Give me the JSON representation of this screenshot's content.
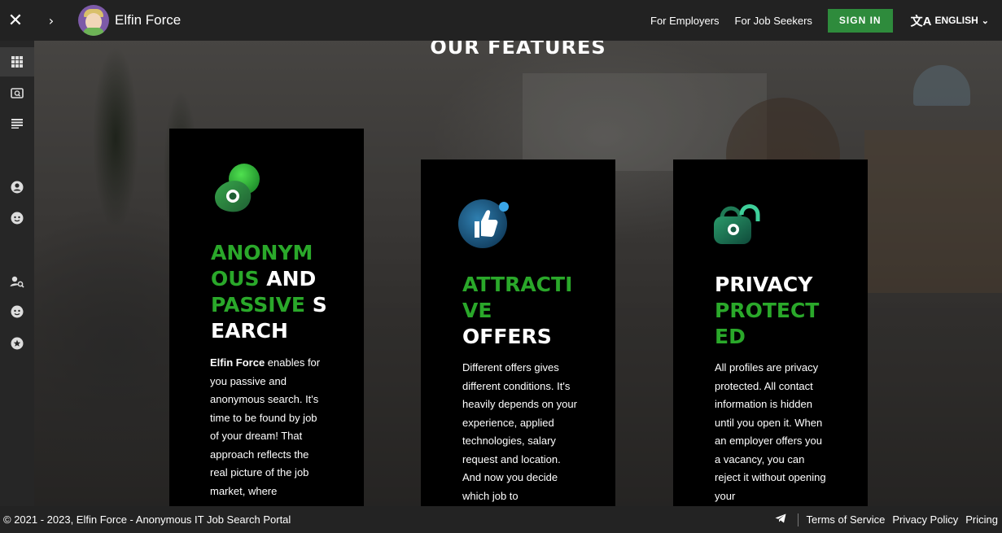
{
  "topbar": {
    "close_icon": "close-icon",
    "expand_icon": "chevron-right-icon",
    "brand": "Elfin Force",
    "for_employers": "For Employers",
    "for_job_seekers": "For Job Seekers",
    "sign_in": "SIGN IN",
    "language": "ENGLISH"
  },
  "sidebar": {
    "icons": [
      "grid-icon",
      "search-screen-icon",
      "list-icon",
      "user-circle-icon",
      "face-icon",
      "user-search-icon",
      "face-icon",
      "star-icon"
    ]
  },
  "main": {
    "section_title": "OUR FEATURES",
    "cards": [
      {
        "icon": "eye-blob-icon",
        "heading_green_1": "ANONYM",
        "heading_green_2": "OUS",
        "heading_white_1": " AND",
        "heading_green_3": "PASSIVE",
        "heading_white_2": " S",
        "heading_white_3": "EARCH",
        "desc_bold": "Elfin Force",
        "desc": " enables for you passive and anonymous search. It's time to be found by job of your dream! That approach reflects the real picture of the job market, where"
      },
      {
        "icon": "thumbs-up-icon",
        "heading_green_1": "ATTRACTI",
        "heading_green_2": "VE",
        "heading_white_1": "OFFERS",
        "desc": "Different offers gives different conditions. It's heavily depends on your experience, applied technologies, salary request and location. And now you decide which job to"
      },
      {
        "icon": "padlock-icon",
        "heading_white_1": "PRIVACY",
        "heading_green_1": "PROTECT",
        "heading_green_2": "ED",
        "desc": "All profiles are privacy protected. All contact information is hidden until you open it. When an employer offers you a vacancy, you can reject it without opening your"
      }
    ]
  },
  "footer": {
    "copyright": "© 2021 - 2023, Elfin Force - Anonymous IT Job Search Portal",
    "telegram_icon": "telegram-icon",
    "terms": "Terms of Service",
    "privacy": "Privacy Policy",
    "pricing": "Pricing"
  },
  "colors": {
    "accent_green": "#2aa82a",
    "signin_green": "#2e8b3c",
    "card_bg": "#000000",
    "bar_bg": "#222222"
  }
}
